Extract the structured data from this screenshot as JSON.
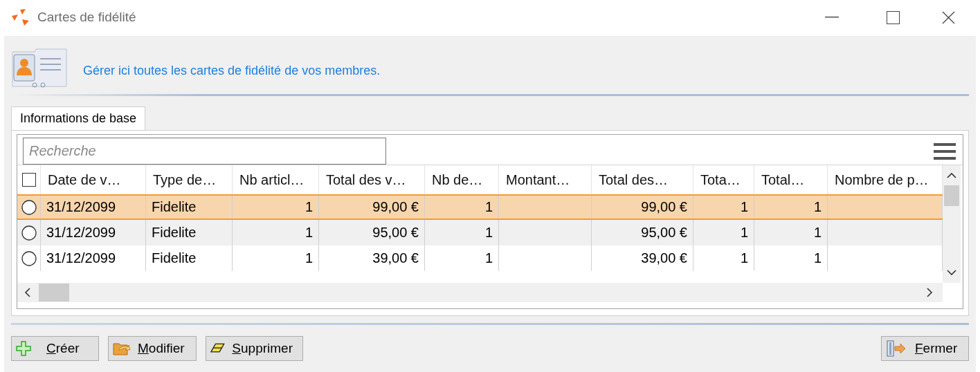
{
  "window": {
    "title": "Cartes de fidélité"
  },
  "header": {
    "description": "Gérer ici toutes les cartes de fidélité de vos membres."
  },
  "tabs": [
    {
      "label": "Informations de base",
      "selected": true
    }
  ],
  "search": {
    "placeholder": "Recherche"
  },
  "table": {
    "select_all_checked": false,
    "columns": [
      "Date de v…",
      "Type de…",
      "Nb articl…",
      "Total des v…",
      "Nb de…",
      "Montant…",
      "Total des…",
      "Tota…",
      "Total…",
      "Nombre de p…"
    ],
    "rows": [
      {
        "selected": true,
        "cells": [
          "31/12/2099",
          "Fidelite",
          "1",
          "99,00 €",
          "1",
          null,
          "99,00 €",
          "1",
          "1",
          null
        ]
      },
      {
        "selected": false,
        "cells": [
          "31/12/2099",
          "Fidelite",
          "1",
          "95,00 €",
          "1",
          null,
          "95,00 €",
          "1",
          "1",
          null
        ]
      },
      {
        "selected": false,
        "cells": [
          "31/12/2099",
          "Fidelite",
          "1",
          "39,00 €",
          "1",
          null,
          "39,00 €",
          "1",
          "1",
          null
        ]
      }
    ]
  },
  "buttons": [
    {
      "label": "Créer",
      "kind": "create"
    },
    {
      "label": "Modifier",
      "kind": "modify"
    },
    {
      "label": "Supprimer",
      "kind": "delete"
    },
    {
      "label": "Fermer",
      "kind": "close"
    }
  ]
}
